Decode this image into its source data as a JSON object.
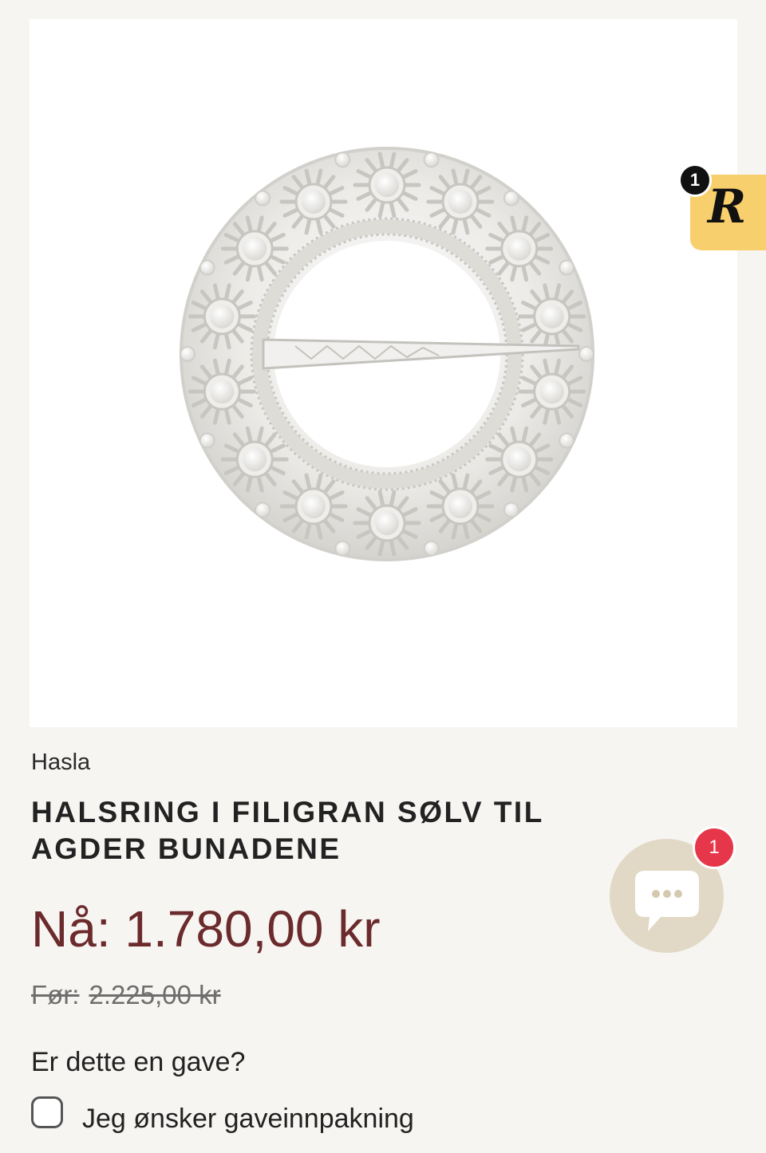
{
  "product": {
    "brand": "Hasla",
    "title": "HALSRING I FILIGRAN SØLV TIL AGDER BUNADENE",
    "price_now": "Nå: 1.780,00 kr",
    "price_before_label": "Før:",
    "price_before_value": "2.225,00 kr"
  },
  "gift": {
    "question": "Er dette en gave?",
    "checkbox_label": "Jeg ønsker gaveinnpakning",
    "checked": false
  },
  "badges": {
    "rewards_letter": "R",
    "rewards_count": "1",
    "chat_count": "1"
  },
  "icons": [
    "rewards-icon",
    "chat-icon",
    "checkbox-icon"
  ],
  "colors": {
    "background": "#f7f5f2",
    "price_now": "#6b2a2c",
    "rewards_badge": "#f7cf6c",
    "chat_button": "#e1d8c5",
    "notification": "#e5364a"
  }
}
